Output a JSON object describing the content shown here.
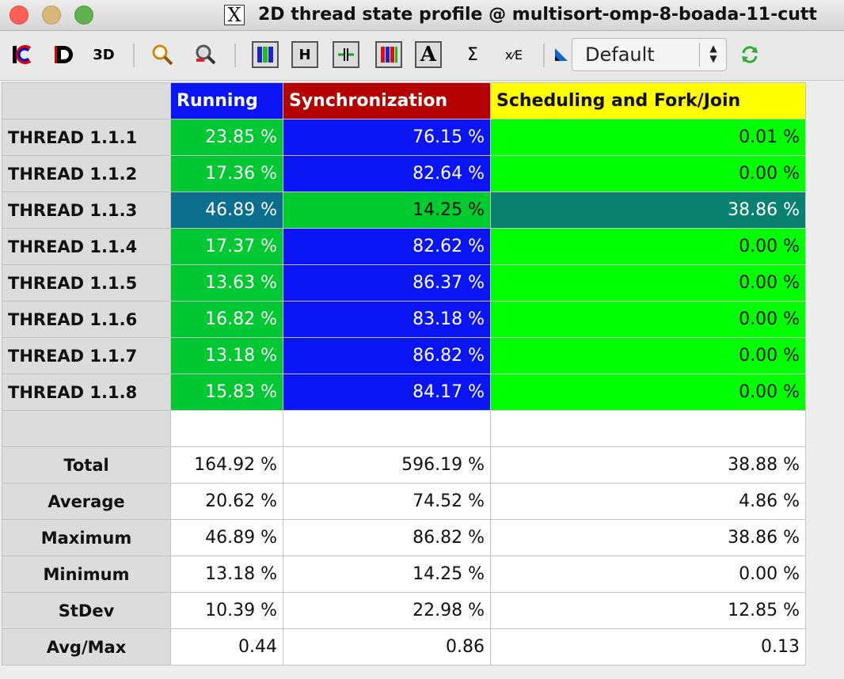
{
  "window": {
    "title": "2D thread state profile @ multisort-omp-8-boada-11-cutt"
  },
  "toolbar": {
    "buttons": [
      {
        "name": "open-control-window-icon",
        "glyph": "IC"
      },
      {
        "name": "open-data-window-icon",
        "glyph": "D"
      },
      {
        "name": "3d-icon",
        "glyph": "3D"
      },
      {
        "name": "zoom-icon",
        "glyph": "🔍"
      },
      {
        "name": "find-icon",
        "glyph": "🔎"
      },
      {
        "name": "vertical-color-bars-icon",
        "glyph": "▮▮"
      },
      {
        "name": "horizontal-icon",
        "glyph": "H"
      },
      {
        "name": "hide-empty-icon",
        "glyph": "⇥⇤"
      },
      {
        "name": "semantic-color-bars-icon",
        "glyph": "▮▮▮"
      },
      {
        "name": "label-icon",
        "glyph": "A"
      },
      {
        "name": "sum-icon",
        "glyph": "Σ"
      },
      {
        "name": "fraction-icon",
        "glyph": "x/E"
      },
      {
        "name": "gradient-icon",
        "glyph": "◣"
      },
      {
        "name": "refresh-icon",
        "glyph": "⇄"
      }
    ],
    "select_value": "Default"
  },
  "table": {
    "columns": [
      "Running",
      "Synchronization",
      "Scheduling and Fork/Join"
    ],
    "rows": [
      {
        "label": "THREAD 1.1.1",
        "values": [
          "23.85 %",
          "76.15 %",
          "0.01 %"
        ]
      },
      {
        "label": "THREAD 1.1.2",
        "values": [
          "17.36 %",
          "82.64 %",
          "0.00 %"
        ]
      },
      {
        "label": "THREAD 1.1.3",
        "values": [
          "46.89 %",
          "14.25 %",
          "38.86 %"
        ]
      },
      {
        "label": "THREAD 1.1.4",
        "values": [
          "17.37 %",
          "82.62 %",
          "0.00 %"
        ]
      },
      {
        "label": "THREAD 1.1.5",
        "values": [
          "13.63 %",
          "86.37 %",
          "0.00 %"
        ]
      },
      {
        "label": "THREAD 1.1.6",
        "values": [
          "16.82 %",
          "83.18 %",
          "0.00 %"
        ]
      },
      {
        "label": "THREAD 1.1.7",
        "values": [
          "13.18 %",
          "86.82 %",
          "0.00 %"
        ]
      },
      {
        "label": "THREAD 1.1.8",
        "values": [
          "15.83 %",
          "84.17 %",
          "0.00 %"
        ]
      }
    ],
    "stats": [
      {
        "label": "Total",
        "values": [
          "164.92 %",
          "596.19 %",
          "38.88 %"
        ]
      },
      {
        "label": "Average",
        "values": [
          "20.62 %",
          "74.52 %",
          "4.86 %"
        ]
      },
      {
        "label": "Maximum",
        "values": [
          "46.89 %",
          "86.82 %",
          "38.86 %"
        ]
      },
      {
        "label": "Minimum",
        "values": [
          "13.18 %",
          "14.25 %",
          "0.00 %"
        ]
      },
      {
        "label": "StDev",
        "values": [
          "10.39 %",
          "22.98 %",
          "12.85 %"
        ]
      },
      {
        "label": "Avg/Max",
        "values": [
          "0.44",
          "0.86",
          "0.13"
        ]
      }
    ],
    "colors": {
      "running_header": "#0a14f5",
      "sync_header": "#b40000",
      "sched_header": "#ffff00",
      "cell_green": "#00c832",
      "cell_blue": "#0a14f5",
      "cell_lime": "#00ff00",
      "cell_teal": "#0a6e8c"
    }
  }
}
